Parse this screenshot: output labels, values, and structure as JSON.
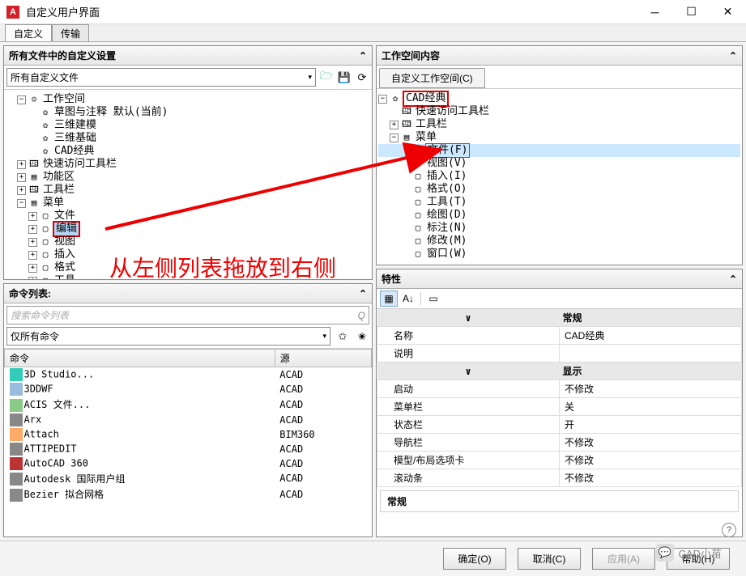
{
  "window": {
    "title": "自定义用户界面",
    "app_letter": "A"
  },
  "top_tabs": {
    "t0": "自定义",
    "t1": "传输"
  },
  "left": {
    "panel1": {
      "title": "所有文件中的自定义设置",
      "dropdown": "所有自定义文件",
      "tree": {
        "workspace_group": "工作空间",
        "ws0": "草图与注释 默认(当前)",
        "ws1": "三维建模",
        "ws2": "三维基础",
        "ws3": "CAD经典",
        "quick_access": "快速访问工具栏",
        "ribbon": "功能区",
        "toolbars": "工具栏",
        "menus": "菜单",
        "m0": "文件",
        "m1": "编辑",
        "m2": "视图",
        "m3": "插入",
        "m4": "格式",
        "m5": "工具"
      }
    },
    "panel2": {
      "title": "命令列表:",
      "search_placeholder": "搜索命令列表",
      "filter": "仅所有命令",
      "col_cmd": "命令",
      "col_src": "源",
      "rows": [
        {
          "c": "3D Studio...",
          "s": "ACAD"
        },
        {
          "c": "3DDWF",
          "s": "ACAD"
        },
        {
          "c": "ACIS 文件...",
          "s": "ACAD"
        },
        {
          "c": "Arx",
          "s": "ACAD"
        },
        {
          "c": "Attach",
          "s": "BIM360"
        },
        {
          "c": "ATTIPEDIT",
          "s": "ACAD"
        },
        {
          "c": "AutoCAD 360",
          "s": "ACAD"
        },
        {
          "c": "Autodesk 国际用户组",
          "s": "ACAD"
        },
        {
          "c": "Bezier 拟合网格",
          "s": "ACAD"
        }
      ]
    }
  },
  "right": {
    "panel1": {
      "title": "工作空间内容",
      "tab": "自定义工作空间(C)",
      "root": "CAD经典",
      "quick": "快速访问工具栏",
      "toolbars": "工具栏",
      "menus": "菜单",
      "m0": "文件(F)",
      "m1": "视图(V)",
      "m2": "插入(I)",
      "m3": "格式(O)",
      "m4": "工具(T)",
      "m5": "绘图(D)",
      "m6": "标注(N)",
      "m7": "修改(M)",
      "m8": "窗口(W)"
    },
    "panel2": {
      "title": "特性",
      "cat_general": "常规",
      "p_name_k": "名称",
      "p_name_v": "CAD经典",
      "p_desc_k": "说明",
      "p_desc_v": "",
      "cat_display": "显示",
      "p_start_k": "启动",
      "p_start_v": "不修改",
      "p_menubar_k": "菜单栏",
      "p_menubar_v": "关",
      "p_status_k": "状态栏",
      "p_status_v": "开",
      "p_nav_k": "导航栏",
      "p_nav_v": "不修改",
      "p_layout_k": "模型/布局选项卡",
      "p_layout_v": "不修改",
      "p_scroll_k": "滚动条",
      "p_scroll_v": "不修改",
      "cat_footer": "常规"
    }
  },
  "footer": {
    "ok": "确定(O)",
    "cancel": "取消(C)",
    "apply": "应用(A)",
    "help": "帮助(H)"
  },
  "overlay": "从左侧列表拖放到右侧",
  "watermark": "CAD小苗"
}
